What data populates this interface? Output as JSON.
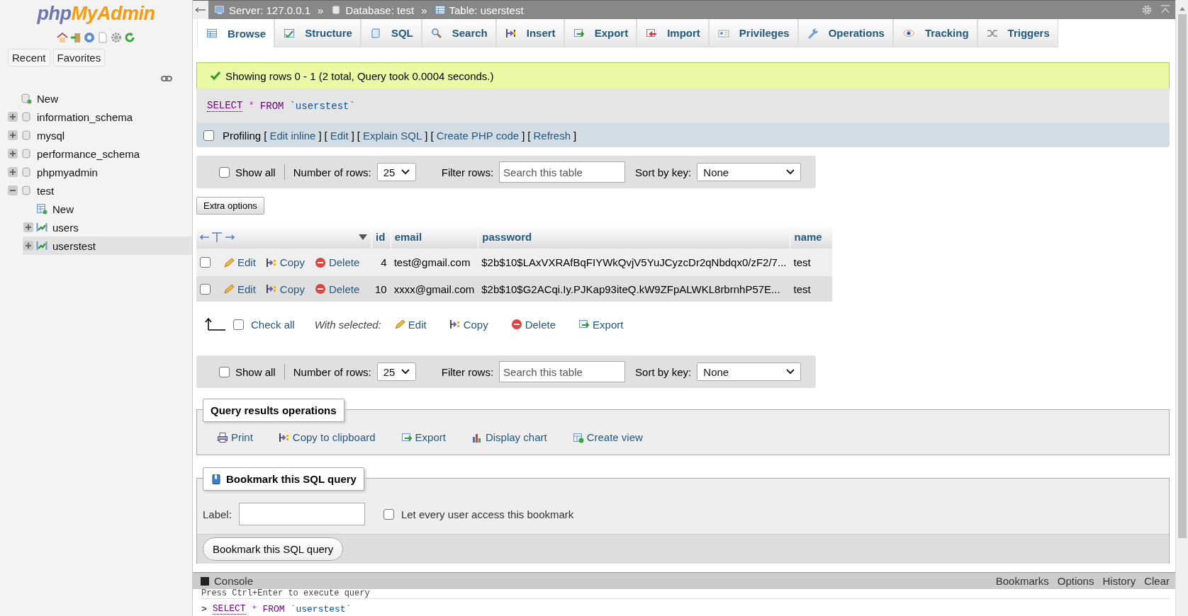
{
  "sidebar": {
    "logo": {
      "php": "php",
      "myadmin": "MyAdmin"
    },
    "tabs": [
      {
        "label": "Recent"
      },
      {
        "label": "Favorites"
      }
    ],
    "tree": [
      {
        "label": "New",
        "kind": "new",
        "selected": false
      },
      {
        "label": "information_schema",
        "kind": "database",
        "expanded": false,
        "selected": false
      },
      {
        "label": "mysql",
        "kind": "database",
        "expanded": false,
        "selected": false
      },
      {
        "label": "performance_schema",
        "kind": "database",
        "expanded": false,
        "selected": false
      },
      {
        "label": "phpmyadmin",
        "kind": "database",
        "expanded": false,
        "selected": false
      },
      {
        "label": "test",
        "kind": "database",
        "expanded": true,
        "selected": false,
        "children": [
          {
            "label": "New",
            "kind": "new_table",
            "selected": false
          },
          {
            "label": "users",
            "kind": "table",
            "expanded": false,
            "selected": false
          },
          {
            "label": "userstest",
            "kind": "table",
            "expanded": false,
            "selected": true
          }
        ]
      }
    ]
  },
  "breadcrumb": {
    "separator": "»",
    "items": [
      "Server: 127.0.0.1",
      "Database: test",
      "Table: userstest"
    ]
  },
  "tabs": [
    {
      "label": "Browse",
      "selected": true
    },
    {
      "label": "Structure",
      "selected": false
    },
    {
      "label": "SQL",
      "selected": false
    },
    {
      "label": "Search",
      "selected": false
    },
    {
      "label": "Insert",
      "selected": false
    },
    {
      "label": "Export",
      "selected": false
    },
    {
      "label": "Import",
      "selected": false
    },
    {
      "label": "Privileges",
      "selected": false
    },
    {
      "label": "Operations",
      "selected": false
    },
    {
      "label": "Tracking",
      "selected": false
    },
    {
      "label": "Triggers",
      "selected": false
    }
  ],
  "message": "Showing rows 0 - 1 (2 total, Query took 0.0004 seconds.)",
  "sql": [
    {
      "text": "SELECT",
      "kind": "keyword"
    },
    {
      "text": "*",
      "kind": "operator"
    },
    {
      "text": "FROM",
      "kind": "keyword"
    },
    {
      "text": "`userstest`",
      "kind": "identifier"
    }
  ],
  "profiling": {
    "label": "Profiling",
    "checked": false,
    "open_bracket": "[",
    "close_bracket": "]",
    "links": [
      "Edit inline",
      "Edit",
      "Explain SQL",
      "Create PHP code",
      "Refresh"
    ]
  },
  "navigation": [
    {
      "show_all": "Show all",
      "checked": false,
      "rows_label": "Number of rows:",
      "rows": "25",
      "filter_label": "Filter rows:",
      "placeholder": "Search this table",
      "sort_label": "Sort by key:",
      "sort": "None"
    },
    {
      "show_all": "Show all",
      "checked": false,
      "rows_label": "Number of rows:",
      "rows": "25",
      "filter_label": "Filter rows:",
      "placeholder": "Search this table",
      "sort_label": "Sort by key:",
      "sort": "None"
    }
  ],
  "extra_options": "Extra options",
  "table": {
    "columns": [
      "id",
      "email",
      "password",
      "name"
    ],
    "rows": [
      {
        "checked": false,
        "actions": [
          "Edit",
          "Copy",
          "Delete"
        ],
        "cells": [
          "4",
          "test@gmail.com",
          "$2b$10$LAxVXRAfBqFIYWkQvjV5YuJCyzcDr2qNbdqx0/zF2/7...",
          "test"
        ]
      },
      {
        "checked": false,
        "actions": [
          "Edit",
          "Copy",
          "Delete"
        ],
        "cells": [
          "10",
          "xxxx@gmail.com",
          "$2b$10$G2ACqi.Iy.PJKap93iteQ.kW9ZFpALWKL8rbrnhP57E...",
          "test"
        ]
      }
    ]
  },
  "bulk": {
    "check_all": "Check all",
    "checked": false,
    "with_selected": "With selected:",
    "actions": [
      "Edit",
      "Copy",
      "Delete",
      "Export"
    ]
  },
  "query_operations": {
    "title": "Query results operations",
    "actions": [
      "Print",
      "Copy to clipboard",
      "Export",
      "Display chart",
      "Create view"
    ]
  },
  "bookmark": {
    "title": "Bookmark this SQL query",
    "label": "Label:",
    "shared_label": "Let every user access this bookmark",
    "shared": false,
    "button": "Bookmark this SQL query"
  },
  "console": {
    "title": "Console",
    "links": [
      "Bookmarks",
      "Options",
      "History",
      "Clear"
    ],
    "hint": "Press Ctrl+Enter to execute query",
    "prompt": ">",
    "query": [
      {
        "text": "SELECT",
        "kind": "keyword"
      },
      {
        "text": "*",
        "kind": "operator"
      },
      {
        "text": "FROM",
        "kind": "keyword"
      },
      {
        "text": "`userstest`",
        "kind": "identifier"
      }
    ]
  }
}
